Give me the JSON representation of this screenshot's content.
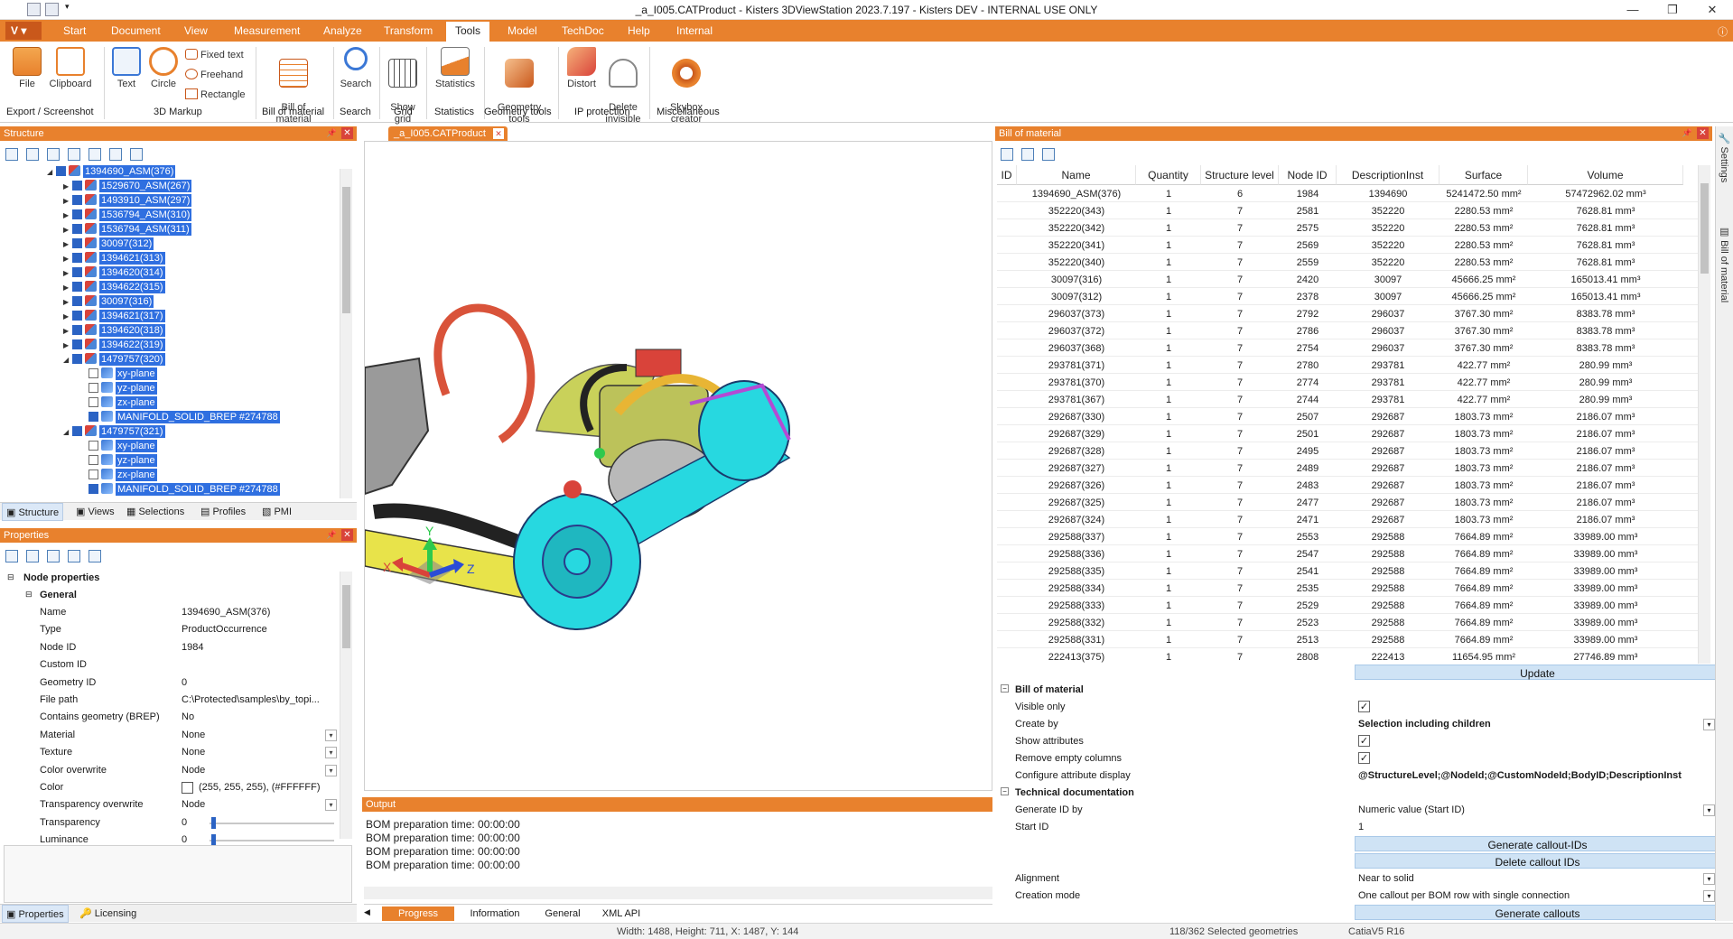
{
  "window": {
    "title": "_a_I005.CATProduct - Kisters 3DViewStation 2023.7.197 - Kisters DEV - INTERNAL USE ONLY"
  },
  "menu": {
    "v_label": "V"
  },
  "tabs": [
    "Start",
    "Document",
    "View",
    "Measurement",
    "Analyze",
    "Transform",
    "Tools",
    "Model",
    "TechDoc",
    "Help",
    "Internal"
  ],
  "active_tab": "Tools",
  "ribbon": {
    "file": "File",
    "clipboard": "Clipboard",
    "text": "Text",
    "circle": "Circle",
    "fixed_text": "Fixed text",
    "freehand": "Freehand",
    "rectangle": "Rectangle",
    "bom": "Bill of\nmaterial",
    "search": "Search",
    "show_grid": "Show\ngrid",
    "statistics": "Statistics",
    "geometry_tools": "Geometry\ntools",
    "distort": "Distort",
    "delete_invisible": "Delete\ninvisible",
    "skybox": "Skybox\ncreator",
    "groups": [
      "Export / Screenshot",
      "3D Markup",
      "Bill of material",
      "Search",
      "Grid",
      "Statistics",
      "Geometry tools",
      "IP protection",
      "Miscellaneous"
    ]
  },
  "structure": {
    "header": "Structure",
    "nodes": [
      {
        "label": "1394690_ASM(376)",
        "indent": 0,
        "exp": "◢",
        "type": "asm"
      },
      {
        "label": "1529670_ASM(267)",
        "indent": 1,
        "exp": "▶",
        "type": "asm"
      },
      {
        "label": "1493910_ASM(297)",
        "indent": 1,
        "exp": "▶",
        "type": "asm"
      },
      {
        "label": "1536794_ASM(310)",
        "indent": 1,
        "exp": "▶",
        "type": "asm"
      },
      {
        "label": "1536794_ASM(311)",
        "indent": 1,
        "exp": "▶",
        "type": "asm"
      },
      {
        "label": "30097(312)",
        "indent": 1,
        "exp": "▶",
        "type": "asm"
      },
      {
        "label": "1394621(313)",
        "indent": 1,
        "exp": "▶",
        "type": "asm"
      },
      {
        "label": "1394620(314)",
        "indent": 1,
        "exp": "▶",
        "type": "asm"
      },
      {
        "label": "1394622(315)",
        "indent": 1,
        "exp": "▶",
        "type": "asm"
      },
      {
        "label": "30097(316)",
        "indent": 1,
        "exp": "▶",
        "type": "asm"
      },
      {
        "label": "1394621(317)",
        "indent": 1,
        "exp": "▶",
        "type": "asm"
      },
      {
        "label": "1394620(318)",
        "indent": 1,
        "exp": "▶",
        "type": "asm"
      },
      {
        "label": "1394622(319)",
        "indent": 1,
        "exp": "▶",
        "type": "asm"
      },
      {
        "label": "1479757(320)",
        "indent": 1,
        "exp": "◢",
        "type": "asm"
      },
      {
        "label": "xy-plane",
        "indent": 2,
        "exp": "",
        "type": "plane",
        "off": true
      },
      {
        "label": "yz-plane",
        "indent": 2,
        "exp": "",
        "type": "plane",
        "off": true
      },
      {
        "label": "zx-plane",
        "indent": 2,
        "exp": "",
        "type": "plane",
        "off": true
      },
      {
        "label": "MANIFOLD_SOLID_BREP #274788",
        "indent": 2,
        "exp": "",
        "type": "plane"
      },
      {
        "label": "1479757(321)",
        "indent": 1,
        "exp": "◢",
        "type": "asm"
      },
      {
        "label": "xy-plane",
        "indent": 2,
        "exp": "",
        "type": "plane",
        "off": true
      },
      {
        "label": "yz-plane",
        "indent": 2,
        "exp": "",
        "type": "plane",
        "off": true
      },
      {
        "label": "zx-plane",
        "indent": 2,
        "exp": "",
        "type": "plane",
        "off": true
      },
      {
        "label": "MANIFOLD_SOLID_BREP #274788",
        "indent": 2,
        "exp": "",
        "type": "plane"
      }
    ],
    "tabs": [
      "Structure",
      "Views",
      "Selections",
      "Profiles",
      "PMI"
    ]
  },
  "properties": {
    "header": "Properties",
    "node_properties": "Node properties",
    "general": "General",
    "rows": [
      {
        "k": "Name",
        "v": "1394690_ASM(376)"
      },
      {
        "k": "Type",
        "v": "ProductOccurrence"
      },
      {
        "k": "Node ID",
        "v": "1984"
      },
      {
        "k": "Custom ID",
        "v": ""
      },
      {
        "k": "Geometry ID",
        "v": "0"
      },
      {
        "k": "File path",
        "v": "C:\\Protected\\samples\\by_topi..."
      },
      {
        "k": "Contains geometry (BREP)",
        "v": "No"
      },
      {
        "k": "Material",
        "v": "None",
        "dd": true
      },
      {
        "k": "Texture",
        "v": "None",
        "dd": true
      },
      {
        "k": "Color overwrite",
        "v": "Node",
        "dd": true
      },
      {
        "k": "Color",
        "v": "(255, 255, 255), (#FFFFFF)"
      },
      {
        "k": "Transparency overwrite",
        "v": "Node",
        "dd": true
      },
      {
        "k": "Transparency",
        "v": "0"
      },
      {
        "k": "Luminance",
        "v": "0"
      }
    ],
    "tabs": [
      "Properties",
      "Licensing"
    ]
  },
  "document_tab": "_a_I005.CATProduct",
  "axes": {
    "x": "X",
    "y": "Y",
    "z": "Z"
  },
  "output": {
    "header": "Output",
    "lines": [
      "BOM preparation time: 00:00:00",
      "BOM preparation time: 00:00:00",
      "BOM preparation time: 00:00:00",
      "BOM preparation time: 00:00:00"
    ],
    "tabs": [
      "Progress",
      "Information",
      "General",
      "XML API"
    ]
  },
  "bom": {
    "header": "Bill of material",
    "columns": [
      "ID",
      "Name",
      "Quantity",
      "Structure level",
      "Node ID",
      "DescriptionInst",
      "Surface",
      "Volume"
    ],
    "rows": [
      [
        "",
        "1394690_ASM(376)",
        "1",
        "6",
        "1984",
        "1394690",
        "5241472.50 mm²",
        "57472962.02 mm³"
      ],
      [
        "",
        "352220(343)",
        "1",
        "7",
        "2581",
        "352220",
        "2280.53 mm²",
        "7628.81 mm³"
      ],
      [
        "",
        "352220(342)",
        "1",
        "7",
        "2575",
        "352220",
        "2280.53 mm²",
        "7628.81 mm³"
      ],
      [
        "",
        "352220(341)",
        "1",
        "7",
        "2569",
        "352220",
        "2280.53 mm²",
        "7628.81 mm³"
      ],
      [
        "",
        "352220(340)",
        "1",
        "7",
        "2559",
        "352220",
        "2280.53 mm²",
        "7628.81 mm³"
      ],
      [
        "",
        "30097(316)",
        "1",
        "7",
        "2420",
        "30097",
        "45666.25 mm²",
        "165013.41 mm³"
      ],
      [
        "",
        "30097(312)",
        "1",
        "7",
        "2378",
        "30097",
        "45666.25 mm²",
        "165013.41 mm³"
      ],
      [
        "",
        "296037(373)",
        "1",
        "7",
        "2792",
        "296037",
        "3767.30 mm²",
        "8383.78 mm³"
      ],
      [
        "",
        "296037(372)",
        "1",
        "7",
        "2786",
        "296037",
        "3767.30 mm²",
        "8383.78 mm³"
      ],
      [
        "",
        "296037(368)",
        "1",
        "7",
        "2754",
        "296037",
        "3767.30 mm²",
        "8383.78 mm³"
      ],
      [
        "",
        "293781(371)",
        "1",
        "7",
        "2780",
        "293781",
        "422.77 mm²",
        "280.99 mm³"
      ],
      [
        "",
        "293781(370)",
        "1",
        "7",
        "2774",
        "293781",
        "422.77 mm²",
        "280.99 mm³"
      ],
      [
        "",
        "293781(367)",
        "1",
        "7",
        "2744",
        "293781",
        "422.77 mm²",
        "280.99 mm³"
      ],
      [
        "",
        "292687(330)",
        "1",
        "7",
        "2507",
        "292687",
        "1803.73 mm²",
        "2186.07 mm³"
      ],
      [
        "",
        "292687(329)",
        "1",
        "7",
        "2501",
        "292687",
        "1803.73 mm²",
        "2186.07 mm³"
      ],
      [
        "",
        "292687(328)",
        "1",
        "7",
        "2495",
        "292687",
        "1803.73 mm²",
        "2186.07 mm³"
      ],
      [
        "",
        "292687(327)",
        "1",
        "7",
        "2489",
        "292687",
        "1803.73 mm²",
        "2186.07 mm³"
      ],
      [
        "",
        "292687(326)",
        "1",
        "7",
        "2483",
        "292687",
        "1803.73 mm²",
        "2186.07 mm³"
      ],
      [
        "",
        "292687(325)",
        "1",
        "7",
        "2477",
        "292687",
        "1803.73 mm²",
        "2186.07 mm³"
      ],
      [
        "",
        "292687(324)",
        "1",
        "7",
        "2471",
        "292687",
        "1803.73 mm²",
        "2186.07 mm³"
      ],
      [
        "",
        "292588(337)",
        "1",
        "7",
        "2553",
        "292588",
        "7664.89 mm²",
        "33989.00 mm³"
      ],
      [
        "",
        "292588(336)",
        "1",
        "7",
        "2547",
        "292588",
        "7664.89 mm²",
        "33989.00 mm³"
      ],
      [
        "",
        "292588(335)",
        "1",
        "7",
        "2541",
        "292588",
        "7664.89 mm²",
        "33989.00 mm³"
      ],
      [
        "",
        "292588(334)",
        "1",
        "7",
        "2535",
        "292588",
        "7664.89 mm²",
        "33989.00 mm³"
      ],
      [
        "",
        "292588(333)",
        "1",
        "7",
        "2529",
        "292588",
        "7664.89 mm²",
        "33989.00 mm³"
      ],
      [
        "",
        "292588(332)",
        "1",
        "7",
        "2523",
        "292588",
        "7664.89 mm²",
        "33989.00 mm³"
      ],
      [
        "",
        "292588(331)",
        "1",
        "7",
        "2513",
        "292588",
        "7664.89 mm²",
        "33989.00 mm³"
      ],
      [
        "",
        "222413(375)",
        "1",
        "7",
        "2808",
        "222413",
        "11654.95 mm²",
        "27746.89 mm³"
      ]
    ],
    "update": "Update",
    "section_bom": "Bill of material",
    "visible_only": "Visible only",
    "create_by": "Create by",
    "create_by_value": "Selection including children",
    "show_attributes": "Show attributes",
    "remove_empty": "Remove empty columns",
    "configure": "Configure attribute display",
    "configure_value": "@StructureLevel;@NodeId;@CustomNodeId;BodyID;DescriptionInst",
    "section_tech": "Technical documentation",
    "generate_id_by": "Generate ID by",
    "generate_id_value": "Numeric value (Start ID)",
    "start_id": "Start ID",
    "start_id_value": "1",
    "gen_callout_ids": "Generate callout-IDs",
    "del_callout_ids": "Delete callout IDs",
    "alignment": "Alignment",
    "alignment_value": "Near to solid",
    "creation_mode": "Creation mode",
    "creation_mode_value": "One callout per BOM row with single connection",
    "gen_callouts": "Generate callouts"
  },
  "sidetabs": [
    "Settings",
    "Bill of material"
  ],
  "status": {
    "dims": "Width: 1488, Height: 711, X: 1487, Y: 144",
    "selected": "118/362 Selected geometries",
    "format": "CatiaV5 R16"
  }
}
